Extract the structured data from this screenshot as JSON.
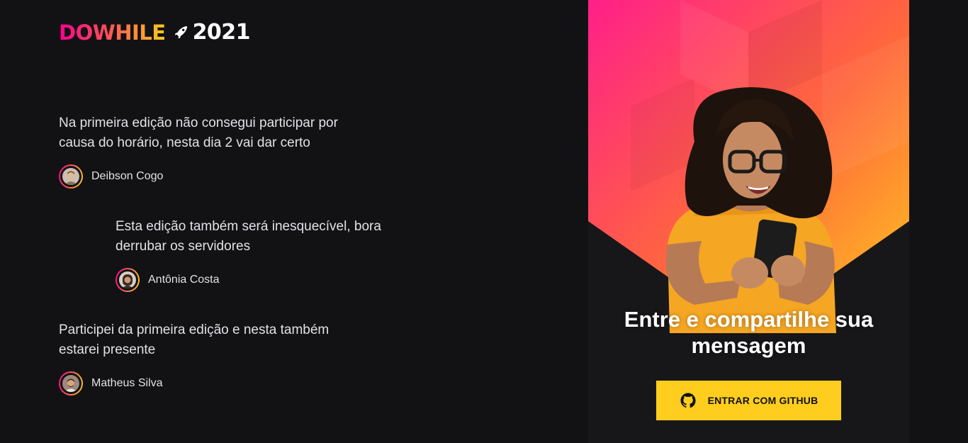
{
  "brand": {
    "logo_word": "DOWHILE",
    "logo_year": "2021"
  },
  "messages": [
    {
      "content": "Na primeira edição não consegui participar por causa do horário, nesta dia 2 vai dar certo",
      "user_name": "Deibson Cogo"
    },
    {
      "content": "Esta edição também será inesquecível, bora derrubar os servidores",
      "user_name": "Antônia Costa"
    },
    {
      "content": "Participei da primeira edição e nesta também estarei presente",
      "user_name": "Matheus Silva"
    }
  ],
  "login": {
    "title": "Entre e compartilhe sua mensagem",
    "button_label": "ENTRAR COM GITHUB"
  },
  "colors": {
    "background": "#121214",
    "panel": "#17171a",
    "gradient_start": "#ff008e",
    "gradient_end": "#ffcd1e",
    "button": "#ffcd1e",
    "text": "#e1e1e6"
  }
}
